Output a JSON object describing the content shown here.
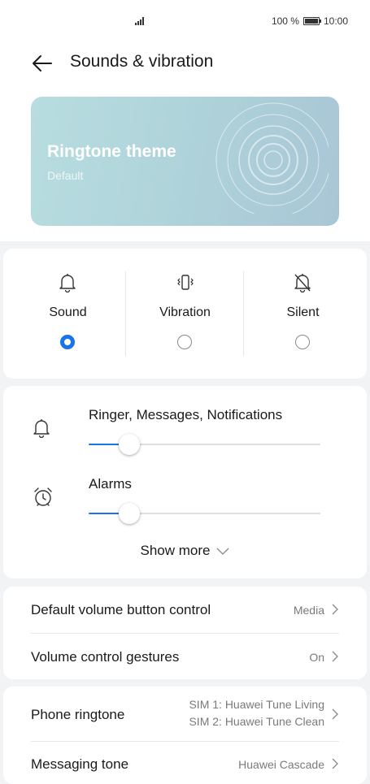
{
  "status_bar": {
    "battery_text": "100 %",
    "time": "10:00"
  },
  "header": {
    "title": "Sounds & vibration"
  },
  "banner": {
    "title": "Ringtone theme",
    "subtitle": "Default"
  },
  "modes": [
    {
      "label": "Sound",
      "selected": true
    },
    {
      "label": "Vibration",
      "selected": false
    },
    {
      "label": "Silent",
      "selected": false
    }
  ],
  "volumes": [
    {
      "label": "Ringer, Messages, Notifications",
      "level": 0.13
    },
    {
      "label": "Alarms",
      "level": 0.13
    }
  ],
  "show_more": "Show more",
  "settings": [
    {
      "label": "Default volume button control",
      "value": "Media"
    },
    {
      "label": "Volume control gestures",
      "value": "On"
    }
  ],
  "ringtones": [
    {
      "label": "Phone ringtone",
      "value_line1": "SIM 1: Huawei Tune Living",
      "value_line2": "SIM 2: Huawei Tune Clean"
    },
    {
      "label": "Messaging tone",
      "value": "Huawei Cascade"
    }
  ],
  "colors": {
    "accent": "#1a73e8",
    "background": "#f1f3f5",
    "banner_start": "#b8dde0",
    "banner_end": "#a9c6d6"
  }
}
